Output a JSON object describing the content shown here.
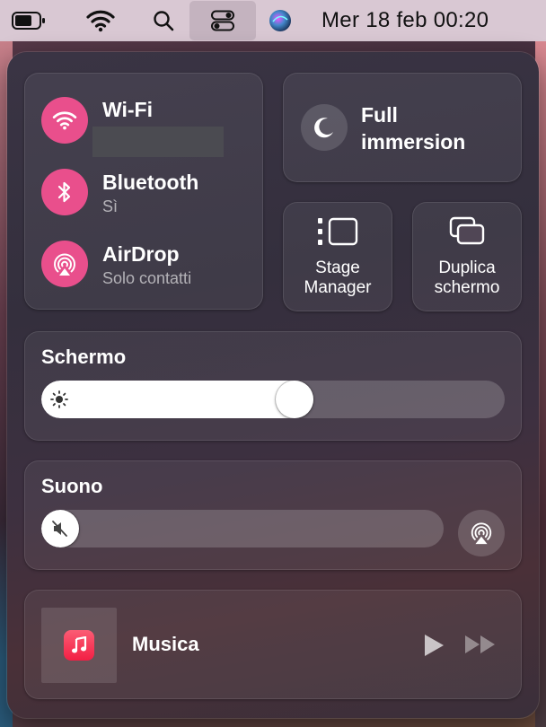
{
  "menubar": {
    "icons": [
      "battery-icon",
      "wifi-icon",
      "search-icon",
      "control-center-icon",
      "siri-icon"
    ],
    "clock": "Mer 18 feb  00:20"
  },
  "connectivity": {
    "wifi": {
      "label": "Wi-Fi",
      "network": "",
      "icon": "wifi-icon",
      "active_color": "#E94F8C"
    },
    "bluetooth": {
      "label": "Bluetooth",
      "status": "Sì",
      "icon": "bluetooth-icon"
    },
    "airdrop": {
      "label": "AirDrop",
      "status": "Solo contatti",
      "icon": "airdrop-icon"
    }
  },
  "focus": {
    "label": "Full immersion",
    "icon": "moon-icon"
  },
  "stage_manager": {
    "label": "Stage Manager",
    "icon": "stage-manager-icon"
  },
  "screen_mirroring": {
    "label": "Duplica schermo",
    "icon": "screen-mirroring-icon"
  },
  "display": {
    "title": "Schermo",
    "brightness_level": 0.55,
    "icon": "sun-icon"
  },
  "sound": {
    "title": "Suono",
    "volume_level": 0.0,
    "icon": "speaker-muted-icon",
    "airplay_icon": "airplay-audio-icon"
  },
  "now_playing": {
    "title": "Musica",
    "app_icon": "music-app-icon",
    "controls": [
      "play-icon",
      "fast-forward-icon"
    ]
  }
}
